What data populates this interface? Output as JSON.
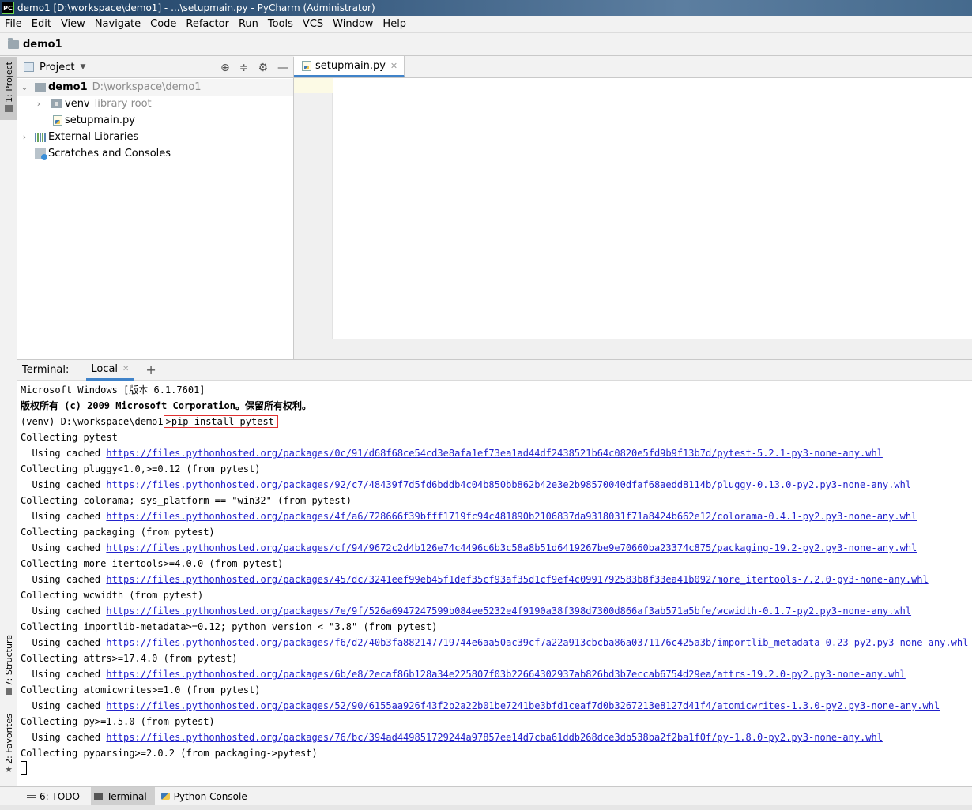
{
  "window": {
    "title": "demo1 [D:\\workspace\\demo1] - ...\\setupmain.py - PyCharm (Administrator)",
    "logo": "PC"
  },
  "menu": [
    "File",
    "Edit",
    "View",
    "Navigate",
    "Code",
    "Refactor",
    "Run",
    "Tools",
    "VCS",
    "Window",
    "Help"
  ],
  "navbar": {
    "project": "demo1"
  },
  "left_stripe": {
    "project": "1: Project",
    "structure": "7: Structure",
    "favorites": "2: Favorites"
  },
  "project_panel": {
    "title": "Project",
    "tree": {
      "root_name": "demo1",
      "root_path": "D:\\workspace\\demo1",
      "venv_name": "venv",
      "venv_note": "library root",
      "file": "setupmain.py",
      "ext_libs": "External Libraries",
      "scratches": "Scratches and Consoles"
    }
  },
  "editor": {
    "tab": "setupmain.py"
  },
  "terminal": {
    "label": "Terminal:",
    "tab": "Local",
    "add": "+",
    "lines": {
      "l0": "Microsoft Windows [版本 6.1.7601]",
      "l1": "版权所有 (c) 2009 Microsoft Corporation。保留所有权利。",
      "l2_prompt": "(venv) D:\\workspace\\demo1",
      "l2_cmd": ">pip install pytest",
      "l3": "Collecting pytest",
      "l4_pre": "  Using cached ",
      "l4_url": "https://files.pythonhosted.org/packages/0c/91/d68f68ce54cd3e8afa1ef73ea1ad44df2438521b64c0820e5fd9b9f13b7d/pytest-5.2.1-py3-none-any.whl",
      "l5": "Collecting pluggy<1.0,>=0.12 (from pytest)",
      "l6_pre": "  Using cached ",
      "l6_url": "https://files.pythonhosted.org/packages/92/c7/48439f7d5fd6bddb4c04b850bb862b42e3e2b98570040dfaf68aedd8114b/pluggy-0.13.0-py2.py3-none-any.whl",
      "l7": "Collecting colorama; sys_platform == \"win32\" (from pytest)",
      "l8_pre": "  Using cached ",
      "l8_url": "https://files.pythonhosted.org/packages/4f/a6/728666f39bfff1719fc94c481890b2106837da9318031f71a8424b662e12/colorama-0.4.1-py2.py3-none-any.whl",
      "l9": "Collecting packaging (from pytest)",
      "l10_pre": "  Using cached ",
      "l10_url": "https://files.pythonhosted.org/packages/cf/94/9672c2d4b126e74c4496c6b3c58a8b51d6419267be9e70660ba23374c875/packaging-19.2-py2.py3-none-any.whl",
      "l11": "Collecting more-itertools>=4.0.0 (from pytest)",
      "l12_pre": "  Using cached ",
      "l12_url": "https://files.pythonhosted.org/packages/45/dc/3241eef99eb45f1def35cf93af35d1cf9ef4c0991792583b8f33ea41b092/more_itertools-7.2.0-py3-none-any.whl",
      "l13": "Collecting wcwidth (from pytest)",
      "l14_pre": "  Using cached ",
      "l14_url": "https://files.pythonhosted.org/packages/7e/9f/526a6947247599b084ee5232e4f9190a38f398d7300d866af3ab571a5bfe/wcwidth-0.1.7-py2.py3-none-any.whl",
      "l15": "Collecting importlib-metadata>=0.12; python_version < \"3.8\" (from pytest)",
      "l16_pre": "  Using cached ",
      "l16_url": "https://files.pythonhosted.org/packages/f6/d2/40b3fa882147719744e6aa50ac39cf7a22a913cbcba86a0371176c425a3b/importlib_metadata-0.23-py2.py3-none-any.whl",
      "l17": "Collecting attrs>=17.4.0 (from pytest)",
      "l18_pre": "  Using cached ",
      "l18_url": "https://files.pythonhosted.org/packages/6b/e8/2ecaf86b128a34e225807f03b22664302937ab826bd3b7eccab6754d29ea/attrs-19.2.0-py2.py3-none-any.whl",
      "l19": "Collecting atomicwrites>=1.0 (from pytest)",
      "l20_pre": "  Using cached ",
      "l20_url": "https://files.pythonhosted.org/packages/52/90/6155aa926f43f2b2a22b01be7241be3bfd1ceaf7d0b3267213e8127d41f4/atomicwrites-1.3.0-py2.py3-none-any.whl",
      "l21": "Collecting py>=1.5.0 (from pytest)",
      "l22_pre": "  Using cached ",
      "l22_url": "https://files.pythonhosted.org/packages/76/bc/394ad449851729244a97857ee14d7cba61ddb268dce3db538ba2f2ba1f0f/py-1.8.0-py2.py3-none-any.whl",
      "l23": "Collecting pyparsing>=2.0.2 (from packaging->pytest)"
    }
  },
  "statusbar": {
    "todo": "6: TODO",
    "terminal": "Terminal",
    "python_console": "Python Console"
  },
  "colors": {
    "accent": "#4083c9",
    "link": "#2222cc",
    "highlight_box": "#e03030"
  }
}
